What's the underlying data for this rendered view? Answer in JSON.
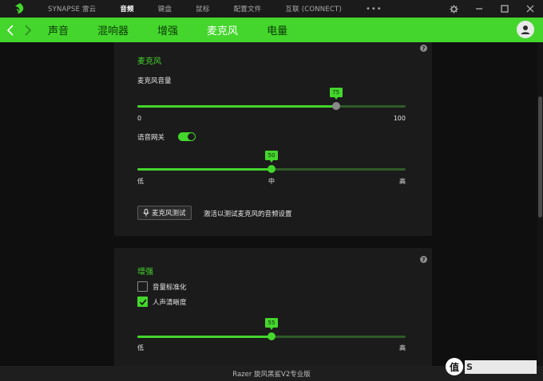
{
  "topnav": {
    "items": [
      "SYNAPSE 雷云",
      "音频",
      "键盘",
      "鼠标",
      "配置文件",
      "互联 (CONNECT)"
    ],
    "more": "•••"
  },
  "subnav": {
    "tabs": [
      "声音",
      "混响器",
      "增强",
      "麦克风",
      "电量"
    ],
    "active_tab": "麦克风"
  },
  "mic_panel": {
    "title": "麦克风",
    "help": "?",
    "volume_label": "麦克风音量",
    "volume_value": "75",
    "volume_min": "0",
    "volume_max": "100",
    "gate_label": "语音网关",
    "gate_on": true,
    "gate_value": "50",
    "gate_ticks": [
      "低",
      "中",
      "高"
    ],
    "test_button": "麦克风测试",
    "test_hint": "激活以测试麦克风的音频设置"
  },
  "enh_panel": {
    "title": "增强",
    "help": "?",
    "normalize_label": "音量标准化",
    "normalize_checked": false,
    "clarity_label": "人声清晰度",
    "clarity_checked": true,
    "clarity_value": "55",
    "clarity_ticks": [
      "低",
      "高"
    ]
  },
  "status": {
    "device": "Razer 旋风黑鲨V2专业版"
  },
  "watermark": {
    "badge": "值",
    "text": "S"
  },
  "colors": {
    "accent": "#44d62c",
    "panel": "#1b1b1b",
    "background": "#0f0f0f"
  }
}
